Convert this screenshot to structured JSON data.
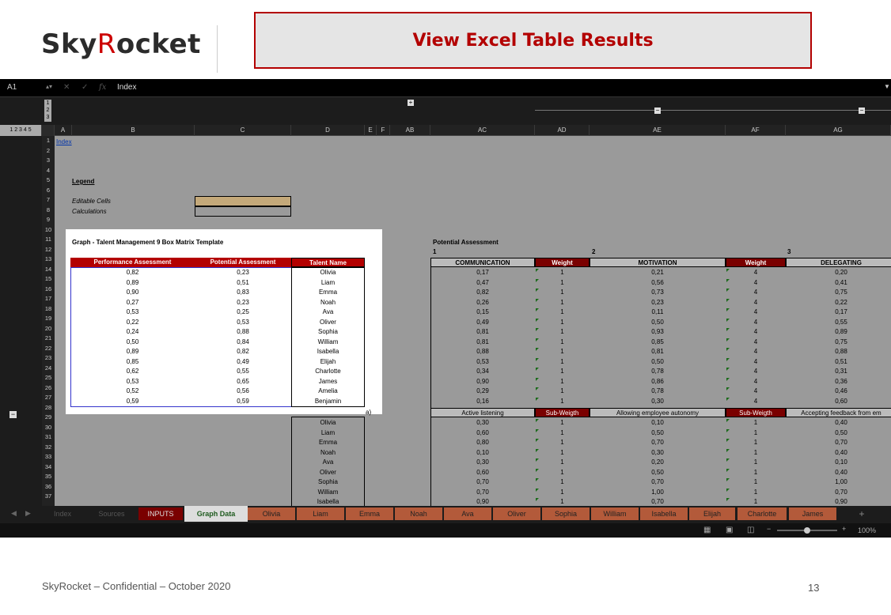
{
  "logo": {
    "part1": "Sky",
    "part2": "R",
    "part3": "ocket"
  },
  "title": "View Excel Table Results",
  "formula_bar": {
    "cell_ref": "A1",
    "fx": "fx",
    "value": "Index"
  },
  "column_headers": [
    "A",
    "B",
    "C",
    "D",
    "E",
    "F",
    "AB",
    "AC",
    "AD",
    "AE",
    "AF",
    "AG"
  ],
  "outline_levels": "1 2 3 4 5",
  "row_numbers": [
    "1",
    "2",
    "3",
    "4",
    "5",
    "6",
    "7",
    "8",
    "9",
    "10",
    "11",
    "12",
    "13",
    "14",
    "15",
    "16",
    "17",
    "18",
    "19",
    "20",
    "21",
    "22",
    "23",
    "24",
    "25",
    "26",
    "27",
    "28",
    "29",
    "30",
    "31",
    "32",
    "33",
    "34",
    "35",
    "36",
    "37"
  ],
  "sheet": {
    "index_link": "Index",
    "legend_label": "Legend",
    "editable_label": "Editable Cells",
    "calc_label": "Calculations",
    "graph_title": "Graph - Talent Management 9 Box Matrix Template",
    "table_headers": [
      "Performance Assessment",
      "Potential Assessment",
      "Talent Name"
    ],
    "table_rows": [
      [
        "0,82",
        "0,23",
        "Olivia"
      ],
      [
        "0,89",
        "0,51",
        "Liam"
      ],
      [
        "0,90",
        "0,83",
        "Emma"
      ],
      [
        "0,27",
        "0,23",
        "Noah"
      ],
      [
        "0,53",
        "0,25",
        "Ava"
      ],
      [
        "0,22",
        "0,53",
        "Oliver"
      ],
      [
        "0,24",
        "0,88",
        "Sophia"
      ],
      [
        "0,50",
        "0,84",
        "William"
      ],
      [
        "0,89",
        "0,82",
        "Isabella"
      ],
      [
        "0,85",
        "0,49",
        "Elijah"
      ],
      [
        "0,62",
        "0,55",
        "Charlotte"
      ],
      [
        "0,53",
        "0,65",
        "James"
      ],
      [
        "0,52",
        "0,56",
        "Amelia"
      ],
      [
        "0,59",
        "0,59",
        "Benjamin"
      ]
    ],
    "a_label": "a)",
    "names_lower": [
      "Olivia",
      "Liam",
      "Emma",
      "Noah",
      "Ava",
      "Oliver",
      "Sophia",
      "William",
      "Isabella"
    ],
    "potential_title": "Potential Assessment",
    "group_nums": [
      "1",
      "2",
      "3"
    ],
    "dim_headers": [
      "COMMUNICATION",
      "Weight",
      "MOTIVATION",
      "Weight",
      "DELEGATING"
    ],
    "dim_rows": [
      [
        "0,17",
        "1",
        "0,21",
        "4",
        "0,20"
      ],
      [
        "0,47",
        "1",
        "0,56",
        "4",
        "0,41"
      ],
      [
        "0,82",
        "1",
        "0,73",
        "4",
        "0,75"
      ],
      [
        "0,26",
        "1",
        "0,23",
        "4",
        "0,22"
      ],
      [
        "0,15",
        "1",
        "0,11",
        "4",
        "0,17"
      ],
      [
        "0,49",
        "1",
        "0,50",
        "4",
        "0,55"
      ],
      [
        "0,81",
        "1",
        "0,93",
        "4",
        "0,89"
      ],
      [
        "0,81",
        "1",
        "0,85",
        "4",
        "0,75"
      ],
      [
        "0,88",
        "1",
        "0,81",
        "4",
        "0,88"
      ],
      [
        "0,53",
        "1",
        "0,50",
        "4",
        "0,51"
      ],
      [
        "0,34",
        "1",
        "0,78",
        "4",
        "0,31"
      ],
      [
        "0,90",
        "1",
        "0,86",
        "4",
        "0,36"
      ],
      [
        "0,29",
        "1",
        "0,78",
        "4",
        "0,46"
      ],
      [
        "0,16",
        "1",
        "0,30",
        "4",
        "0,60"
      ]
    ],
    "sub_headers": [
      "Active listening",
      "Sub-Weigth",
      "Allowing employee autonomy",
      "Sub-Weigth",
      "Accepting feedback from em"
    ],
    "sub_rows": [
      [
        "0,30",
        "1",
        "0,10",
        "1",
        "0,40"
      ],
      [
        "0,60",
        "1",
        "0,50",
        "1",
        "0,50"
      ],
      [
        "0,80",
        "1",
        "0,70",
        "1",
        "0,70"
      ],
      [
        "0,10",
        "1",
        "0,30",
        "1",
        "0,40"
      ],
      [
        "0,30",
        "1",
        "0,20",
        "1",
        "0,10"
      ],
      [
        "0,60",
        "1",
        "0,50",
        "1",
        "0,40"
      ],
      [
        "0,70",
        "1",
        "0,70",
        "1",
        "1,00"
      ],
      [
        "0,70",
        "1",
        "1,00",
        "1",
        "0,70"
      ],
      [
        "0,90",
        "1",
        "0,70",
        "1",
        "0,90"
      ]
    ]
  },
  "tabs": [
    "Index",
    "Sources",
    "INPUTS",
    "Graph Data",
    "Olivia",
    "Liam",
    "Emma",
    "Noah",
    "Ava",
    "Oliver",
    "Sophia",
    "William",
    "Isabella",
    "Elijah",
    "Charlotte",
    "James"
  ],
  "add_tab": "+",
  "zoom": "100%",
  "zoom_minus": "−",
  "zoom_plus": "+",
  "footer": "SkyRocket – Confidential – October 2020",
  "page_number": "13",
  "colors": {
    "accent": "#b30000",
    "person_tab": "#b35a3a",
    "dark_red": "#7a0000",
    "editable": "#c4a97a"
  }
}
